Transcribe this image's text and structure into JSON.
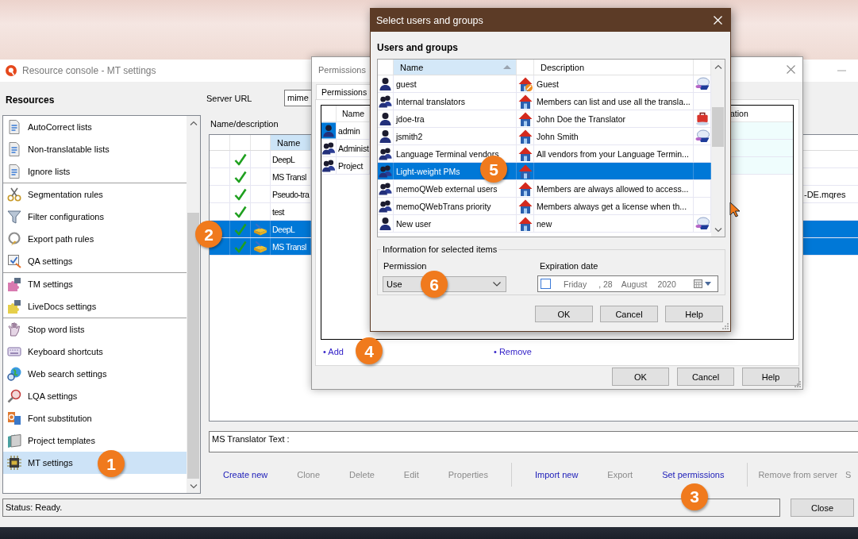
{
  "main_window": {
    "title": "Resource console - MT settings",
    "sidebar": {
      "heading": "Resources",
      "groups": [
        [
          {
            "label": "AutoCorrect lists",
            "selected": false
          },
          {
            "label": "Non-translatable lists",
            "selected": false
          },
          {
            "label": "Ignore lists",
            "selected": false
          }
        ],
        [
          {
            "label": "Segmentation rules",
            "selected": false
          },
          {
            "label": "Filter configurations",
            "selected": false
          },
          {
            "label": "Export path rules",
            "selected": false
          },
          {
            "label": "QA settings",
            "selected": false
          }
        ],
        [
          {
            "label": "TM settings",
            "selected": false
          },
          {
            "label": "LiveDocs settings",
            "selected": false
          }
        ],
        [
          {
            "label": "Stop word lists",
            "selected": false
          },
          {
            "label": "Keyboard shortcuts",
            "selected": false
          },
          {
            "label": "Web search settings",
            "selected": false
          },
          {
            "label": "LQA settings",
            "selected": false
          },
          {
            "label": "Font substitution",
            "selected": false
          },
          {
            "label": "Project templates",
            "selected": false
          },
          {
            "label": "MT settings",
            "selected": true,
            "callout": "1"
          }
        ]
      ]
    },
    "server_url": {
      "label": "Server URL",
      "value": "mime"
    },
    "list_label": "Name/description",
    "table": {
      "name_column": {
        "label": "Name",
        "sorted": true
      },
      "rows": [
        {
          "name": "DeepL",
          "checked": true,
          "marked": false,
          "selected": false
        },
        {
          "name": "MS Transl",
          "checked": true,
          "marked": false,
          "selected": false
        },
        {
          "name": "Pseudo-tra",
          "checked": true,
          "marked": false,
          "selected": false,
          "column_5": "-DE.mqres"
        },
        {
          "name": "test",
          "checked": true,
          "marked": false,
          "selected": false
        },
        {
          "name": "DeepL",
          "checked": true,
          "marked": true,
          "selected": true,
          "callout": "2"
        },
        {
          "name": "MS Transl",
          "checked": true,
          "marked": true,
          "selected": true
        }
      ]
    },
    "description": "MS Translator Text :",
    "toolbar": [
      [
        {
          "label": "Create new",
          "enabled": true
        },
        {
          "label": "Clone",
          "enabled": false
        },
        {
          "label": "Delete",
          "enabled": false
        },
        {
          "label": "Edit",
          "enabled": false
        },
        {
          "label": "Properties",
          "enabled": false
        }
      ],
      [
        {
          "label": "Import new",
          "enabled": true
        },
        {
          "label": "Export",
          "enabled": false
        },
        {
          "label": "Set permissions",
          "enabled": true,
          "callout": "3"
        }
      ],
      [
        {
          "label": "Remove from server",
          "enabled": false
        },
        {
          "label": "S",
          "enabled": false
        }
      ]
    ],
    "status": "Status: Ready.",
    "close_button": "Close"
  },
  "permissions_dialog": {
    "title": "Permissions",
    "tabs": [
      {
        "label": "Permissions",
        "selected": true
      }
    ],
    "columns": [
      "Name",
      "ation"
    ],
    "rows": [
      {
        "kind": "user",
        "name": "admin",
        "selected": true
      },
      {
        "kind": "group",
        "name": "Administ",
        "selected": false
      },
      {
        "kind": "group",
        "name": "Project",
        "selected": false
      }
    ],
    "links": [
      {
        "label": "• Add",
        "callout": "4"
      },
      {
        "label": "• Remove"
      }
    ],
    "buttons": [
      "OK",
      "Cancel",
      "Help"
    ]
  },
  "select_dialog": {
    "title": "Select users and groups",
    "heading": "Users and groups",
    "columns": [
      {
        "label": "Name",
        "sorted": true
      },
      {
        "label": "Description",
        "sorted": false
      }
    ],
    "rows": [
      {
        "kind": "user",
        "name": "guest",
        "restricted": true,
        "description": "Guest",
        "account": {
          "kind": "standard"
        },
        "selected": false
      },
      {
        "kind": "group",
        "name": "Internal translators",
        "restricted": false,
        "description": "Members can list and use all the transla...",
        "selected": false
      },
      {
        "kind": "user",
        "name": "jdoe-tra",
        "restricted": false,
        "description": "John Doe the Translator",
        "account": {
          "kind": "translator"
        },
        "selected": false
      },
      {
        "kind": "user",
        "name": "jsmith2",
        "restricted": false,
        "description": "John Smith",
        "account": {
          "kind": "standard"
        },
        "selected": false
      },
      {
        "kind": "group",
        "name": "Language Terminal vendors",
        "restricted": false,
        "description": "All vendors from your Language Termin...",
        "selected": false
      },
      {
        "kind": "group",
        "name": "Light-weight PMs",
        "restricted": false,
        "selected": true,
        "callout": "5"
      },
      {
        "kind": "group",
        "name": "memoQWeb external users",
        "restricted": false,
        "description": "Members are always allowed to access...",
        "selected": false
      },
      {
        "kind": "group",
        "name": "memoQWebTrans priority",
        "restricted": false,
        "description": "Members always get a license when th...",
        "selected": false
      },
      {
        "kind": "user",
        "name": "New user",
        "restricted": false,
        "description": "new",
        "account": {
          "kind": "standard"
        },
        "selected": false
      }
    ],
    "info_group": {
      "title": "Information for selected items",
      "permission": {
        "label": "Permission",
        "value": "Use",
        "callout": "6"
      },
      "expiration": {
        "label": "Expiration date",
        "checked": false,
        "weekday": "Friday",
        "day": ", 28",
        "month": "August",
        "year": "2020"
      }
    },
    "buttons": [
      "OK",
      "Cancel",
      "Help"
    ]
  }
}
